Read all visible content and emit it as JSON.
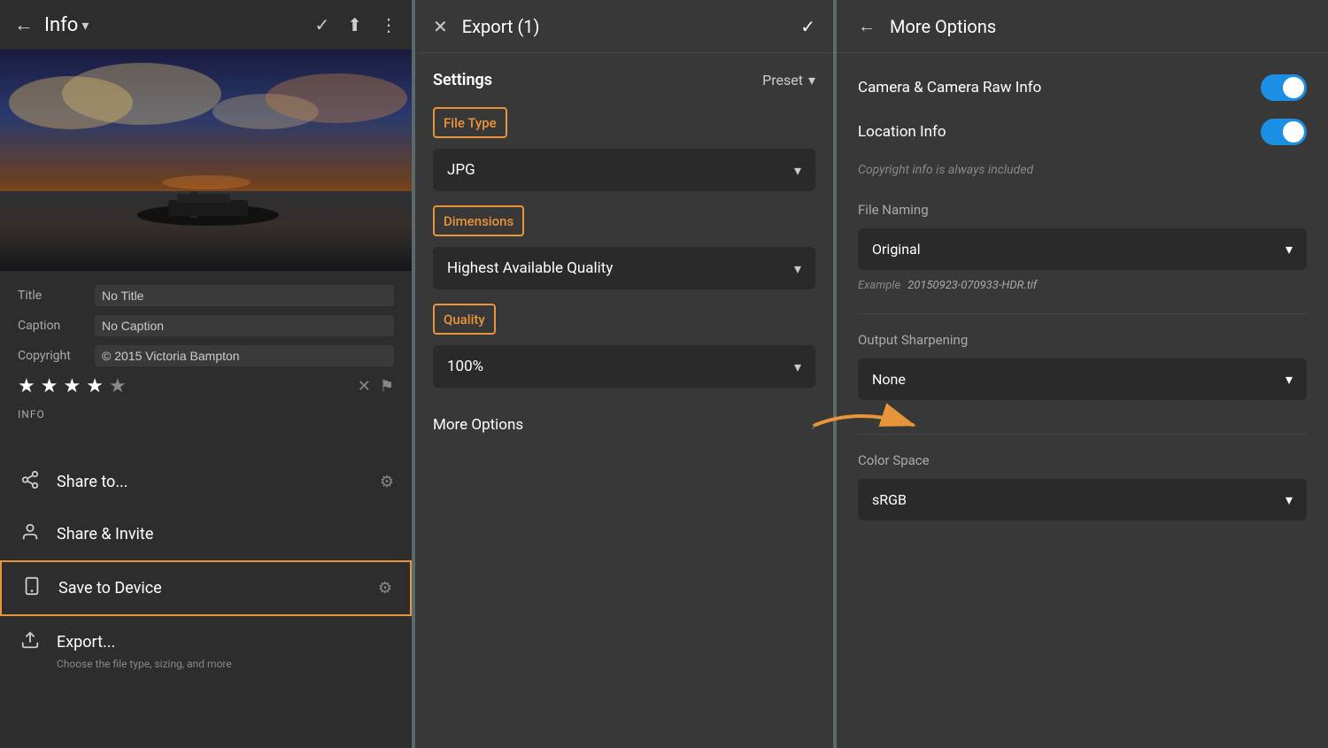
{
  "left": {
    "back_icon": "←",
    "title": "Info",
    "chevron": "▾",
    "icons": {
      "check": "✓",
      "share": "⬆",
      "more": "⋮"
    },
    "metadata": {
      "title_label": "Title",
      "title_value": "No Title",
      "caption_label": "Caption",
      "caption_value": "No Caption",
      "copyright_label": "Copyright",
      "copyright_value": "© 2015 Victoria Bampton"
    },
    "stars": [
      true,
      true,
      true,
      true,
      false
    ],
    "info_section": "INFO",
    "menu": [
      {
        "icon": "↑",
        "label": "Share to...",
        "has_gear": true
      },
      {
        "icon": "👤",
        "label": "Share & Invite",
        "has_gear": false
      },
      {
        "icon": "📱",
        "label": "Save to Device",
        "has_gear": true,
        "highlighted": true
      },
      {
        "icon": "↗",
        "label": "Export...",
        "sub": "Choose the file type, sizing, and more",
        "has_gear": false
      }
    ]
  },
  "middle": {
    "close_icon": "✕",
    "title": "Export (1)",
    "check_icon": "✓",
    "settings_label": "Settings",
    "preset_label": "Preset",
    "preset_chevron": "▾",
    "file_type": {
      "label": "File Type",
      "value": "JPG",
      "chevron": "▾"
    },
    "dimensions": {
      "label": "Dimensions",
      "value": "Highest Available Quality",
      "chevron": "▾"
    },
    "quality": {
      "label": "Quality",
      "value": "100%",
      "chevron": "▾"
    },
    "more_options": {
      "label": "More Options",
      "chevron": "›"
    }
  },
  "right": {
    "back_icon": "←",
    "title": "More Options",
    "toggles": [
      {
        "label": "Camera & Camera Raw Info",
        "enabled": true
      },
      {
        "label": "Location Info",
        "enabled": true
      }
    ],
    "copyright_note": "Copyright info is always included",
    "file_naming": {
      "label": "File Naming",
      "value": "Original",
      "chevron": "▾",
      "example_word": "Example",
      "example_value": "20150923-070933-HDR.tif"
    },
    "output_sharpening": {
      "label": "Output Sharpening",
      "value": "None",
      "chevron": "▾"
    },
    "color_space": {
      "label": "Color Space",
      "value": "sRGB",
      "chevron": "▾"
    }
  }
}
